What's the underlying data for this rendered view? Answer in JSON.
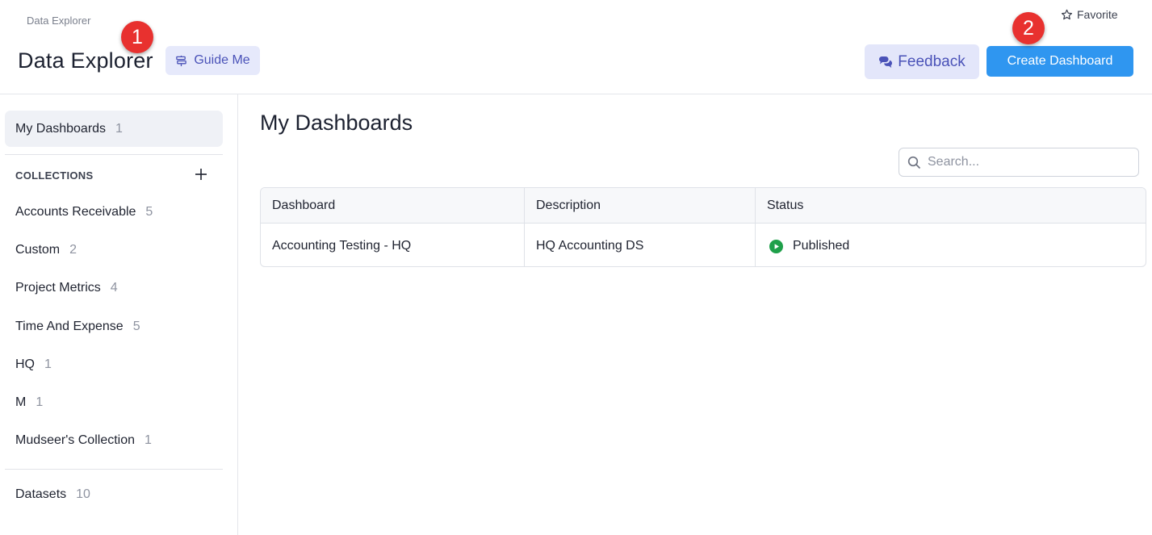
{
  "header": {
    "breadcrumb": "Data Explorer",
    "title": "Data Explorer",
    "guide_label": "Guide Me",
    "favorite_label": "Favorite",
    "feedback_label": "Feedback",
    "create_label": "Create Dashboard",
    "badges": [
      "1",
      "2"
    ]
  },
  "sidebar": {
    "active": {
      "label": "My Dashboards",
      "count": "1"
    },
    "collections_label": "COLLECTIONS",
    "collections": [
      {
        "label": "Accounts Receivable",
        "count": "5"
      },
      {
        "label": "Custom",
        "count": "2"
      },
      {
        "label": "Project Metrics",
        "count": "4"
      },
      {
        "label": "Time And Expense",
        "count": "5"
      },
      {
        "label": "HQ",
        "count": "1"
      },
      {
        "label": "M",
        "count": "1"
      },
      {
        "label": "Mudseer's Collection",
        "count": "1"
      }
    ],
    "datasets": {
      "label": "Datasets",
      "count": "10"
    }
  },
  "main": {
    "title": "My Dashboards",
    "search_placeholder": "Search...",
    "columns": [
      "Dashboard",
      "Description",
      "Status"
    ],
    "rows": [
      {
        "dashboard": "Accounting Testing - HQ",
        "description": "HQ Accounting DS",
        "status": "Published"
      }
    ]
  },
  "colors": {
    "accent": "#2f96f0",
    "badge": "#e8312f",
    "published": "#1fa04a",
    "guide_bg": "#e6e9fb"
  }
}
